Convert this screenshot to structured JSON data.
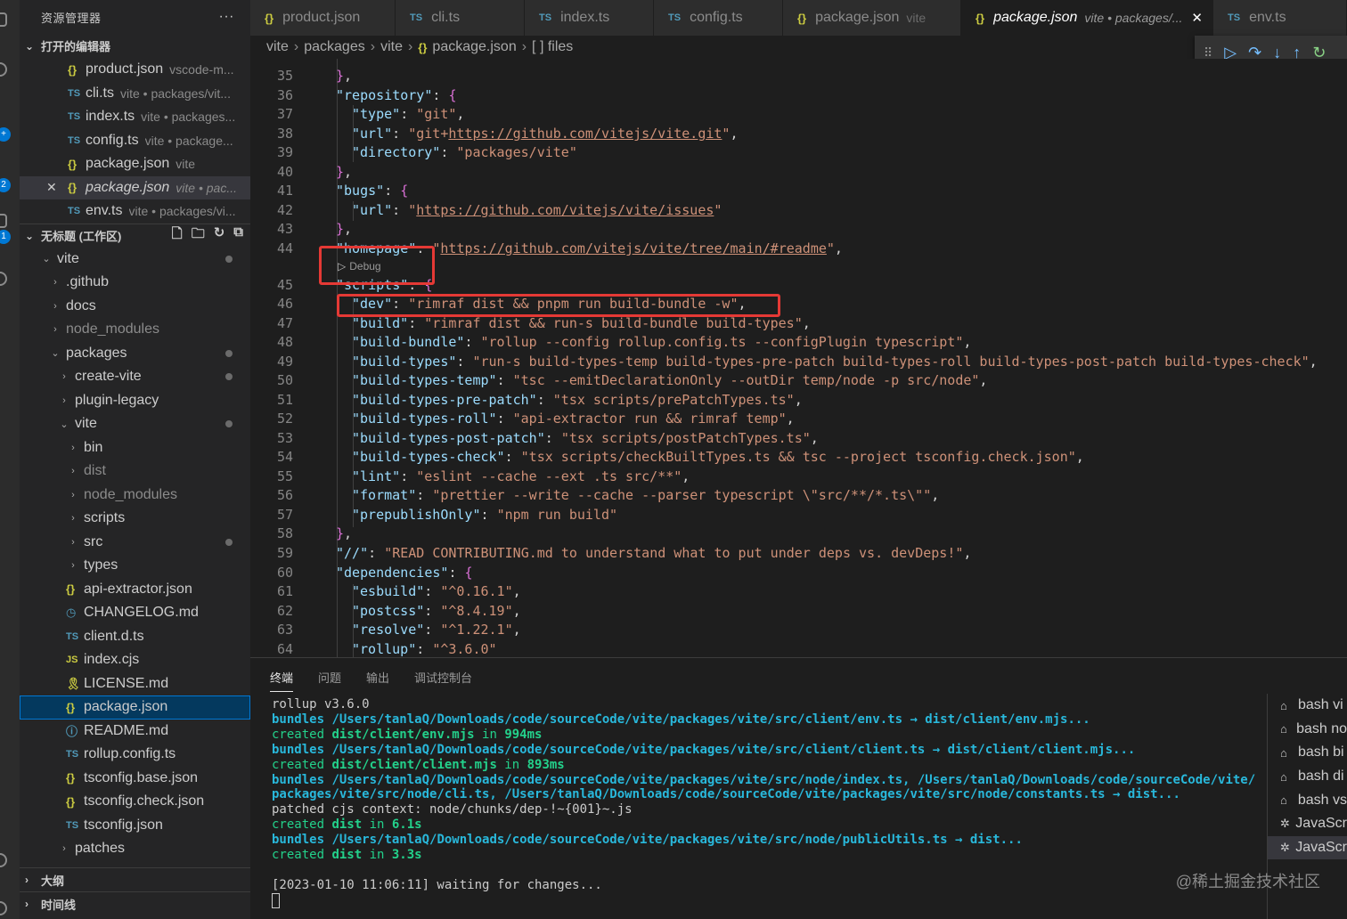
{
  "explorer": {
    "title": "资源管理器",
    "more": "···",
    "open_editors": {
      "title": "打开的编辑器",
      "items": [
        {
          "icon": "{}",
          "name": "product.json",
          "desc": "vscode-m..."
        },
        {
          "icon": "TS",
          "name": "cli.ts",
          "desc": "vite • packages/vit..."
        },
        {
          "icon": "TS",
          "name": "index.ts",
          "desc": "vite • packages..."
        },
        {
          "icon": "TS",
          "name": "config.ts",
          "desc": "vite • package..."
        },
        {
          "icon": "{}",
          "name": "package.json",
          "desc": "vite"
        },
        {
          "icon": "{}",
          "name": "package.json",
          "desc": "vite • pac...",
          "close": "✕"
        },
        {
          "icon": "TS",
          "name": "env.ts",
          "desc": "vite • packages/vi..."
        }
      ]
    },
    "workspace": {
      "title": "无标题 (工作区)",
      "tree": [
        {
          "chev": "⌄",
          "name": "vite"
        },
        {
          "chev": "›",
          "name": ".github"
        },
        {
          "chev": "›",
          "name": "docs"
        },
        {
          "chev": "›",
          "name": "node_modules"
        },
        {
          "chev": "⌄",
          "name": "packages"
        },
        {
          "chev": "›",
          "name": "create-vite"
        },
        {
          "chev": "›",
          "name": "plugin-legacy"
        },
        {
          "chev": "⌄",
          "name": "vite"
        },
        {
          "chev": "›",
          "name": "bin"
        },
        {
          "chev": "›",
          "name": "dist"
        },
        {
          "chev": "›",
          "name": "node_modules"
        },
        {
          "chev": "›",
          "name": "scripts"
        },
        {
          "chev": "›",
          "name": "src"
        },
        {
          "chev": "›",
          "name": "types"
        },
        {
          "icon": "{}",
          "name": "api-extractor.json"
        },
        {
          "icon": "◷",
          "name": "CHANGELOG.md"
        },
        {
          "icon": "TS",
          "name": "client.d.ts"
        },
        {
          "icon": "JS",
          "name": "index.cjs"
        },
        {
          "icon": "🎗",
          "name": "LICENSE.md"
        },
        {
          "icon": "{}",
          "name": "package.json"
        },
        {
          "icon": "ⓘ",
          "name": "README.md"
        },
        {
          "icon": "TS",
          "name": "rollup.config.ts"
        },
        {
          "icon": "{}",
          "name": "tsconfig.base.json"
        },
        {
          "icon": "{}",
          "name": "tsconfig.check.json"
        },
        {
          "icon": "TS",
          "name": "tsconfig.json"
        },
        {
          "chev": "›",
          "name": "patches"
        }
      ]
    },
    "outline": "大纲",
    "timeline": "时间线"
  },
  "tabs": [
    {
      "icon": "{}",
      "label": "product.json",
      "desc": ""
    },
    {
      "icon": "TS",
      "label": "cli.ts",
      "desc": ""
    },
    {
      "icon": "TS",
      "label": "index.ts",
      "desc": ""
    },
    {
      "icon": "TS",
      "label": "config.ts",
      "desc": ""
    },
    {
      "icon": "{}",
      "label": "package.json",
      "desc": "vite"
    },
    {
      "icon": "{}",
      "label": "package.json",
      "desc": "vite • packages/...",
      "close": "✕"
    },
    {
      "icon": "TS",
      "label": "env.ts",
      "desc": ""
    }
  ],
  "breadcrumb": {
    "parts": [
      "vite",
      "packages",
      "vite"
    ],
    "file": "package.json",
    "file_icon": "{}",
    "symbol": "[ ] files"
  },
  "codelens": "Debug",
  "editor": {
    "lines": [
      {
        "n": "35",
        "t": "},"
      },
      {
        "n": "36",
        "t": "\"repository\": {"
      },
      {
        "n": "37",
        "t": "\"type\": \"git\","
      },
      {
        "n": "38",
        "t": "\"url\": \"git+https://github.com/vitejs/vite.git\","
      },
      {
        "n": "39",
        "t": "\"directory\": \"packages/vite\""
      },
      {
        "n": "40",
        "t": "},"
      },
      {
        "n": "41",
        "t": "\"bugs\": {"
      },
      {
        "n": "42",
        "t": "\"url\": \"https://github.com/vitejs/vite/issues\""
      },
      {
        "n": "43",
        "t": "},"
      },
      {
        "n": "44",
        "t": "\"homepage\": \"https://github.com/vitejs/vite/tree/main/#readme\","
      },
      {
        "n": "45",
        "t": "\"scripts\": {"
      },
      {
        "n": "46",
        "t": "\"dev\": \"rimraf dist && pnpm run build-bundle -w\","
      },
      {
        "n": "47",
        "t": "\"build\": \"rimraf dist && run-s build-bundle build-types\","
      },
      {
        "n": "48",
        "t": "\"build-bundle\": \"rollup --config rollup.config.ts --configPlugin typescript\","
      },
      {
        "n": "49",
        "t": "\"build-types\": \"run-s build-types-temp build-types-pre-patch build-types-roll build-types-post-patch build-types-check\","
      },
      {
        "n": "50",
        "t": "\"build-types-temp\": \"tsc --emitDeclarationOnly --outDir temp/node -p src/node\","
      },
      {
        "n": "51",
        "t": "\"build-types-pre-patch\": \"tsx scripts/prePatchTypes.ts\","
      },
      {
        "n": "52",
        "t": "\"build-types-roll\": \"api-extractor run && rimraf temp\","
      },
      {
        "n": "53",
        "t": "\"build-types-post-patch\": \"tsx scripts/postPatchTypes.ts\","
      },
      {
        "n": "54",
        "t": "\"build-types-check\": \"tsx scripts/checkBuiltTypes.ts && tsc --project tsconfig.check.json\","
      },
      {
        "n": "55",
        "t": "\"lint\": \"eslint --cache --ext .ts src/**\","
      },
      {
        "n": "56",
        "t": "\"format\": \"prettier --write --cache --parser typescript \\\"src/**/*.ts\\\"\","
      },
      {
        "n": "57",
        "t": "\"prepublishOnly\": \"npm run build\""
      },
      {
        "n": "58",
        "t": "},"
      },
      {
        "n": "59",
        "t": "\"//\": \"READ CONTRIBUTING.md to understand what to put under deps vs. devDeps!\","
      },
      {
        "n": "60",
        "t": "\"dependencies\": {"
      },
      {
        "n": "61",
        "t": "\"esbuild\": \"^0.16.1\","
      },
      {
        "n": "62",
        "t": "\"postcss\": \"^8.4.19\","
      },
      {
        "n": "63",
        "t": "\"resolve\": \"^1.22.1\","
      },
      {
        "n": "64",
        "t": "\"rollup\": \"^3.6.0\""
      }
    ]
  },
  "panel": {
    "tabs": [
      "终端",
      "问题",
      "输出",
      "调试控制台"
    ],
    "terminal": [
      {
        "parts": [
          {
            "c": "",
            "t": "rollup v3.6.0"
          }
        ]
      },
      {
        "parts": [
          {
            "c": "t-cyan",
            "t": "bundles "
          },
          {
            "c": "t-cyan",
            "t": "/Users/tanlaQ/Downloads/code/sourceCode/vite/packages/vite/src/client/env.ts → dist/client/env.mjs..."
          }
        ]
      },
      {
        "parts": [
          {
            "c": "t-green",
            "t": "created "
          },
          {
            "c": "t-greenb",
            "t": "dist/client/env.mjs"
          },
          {
            "c": "t-green",
            "t": " in "
          },
          {
            "c": "t-greenb",
            "t": "994ms"
          }
        ]
      },
      {
        "parts": [
          {
            "c": "t-cyan",
            "t": "bundles "
          },
          {
            "c": "t-cyan",
            "t": "/Users/tanlaQ/Downloads/code/sourceCode/vite/packages/vite/src/client/client.ts → dist/client/client.mjs..."
          }
        ]
      },
      {
        "parts": [
          {
            "c": "t-green",
            "t": "created "
          },
          {
            "c": "t-greenb",
            "t": "dist/client/client.mjs"
          },
          {
            "c": "t-green",
            "t": " in "
          },
          {
            "c": "t-greenb",
            "t": "893ms"
          }
        ]
      },
      {
        "parts": [
          {
            "c": "t-cyan",
            "t": "bundles "
          },
          {
            "c": "t-cyan",
            "t": "/Users/tanlaQ/Downloads/code/sourceCode/vite/packages/vite/src/node/index.ts, /Users/tanlaQ/Downloads/code/sourceCode/vite/packages/vite/src/node/cli.ts, /Users/tanlaQ/Downloads/code/sourceCode/vite/packages/vite/src/node/constants.ts → dist..."
          }
        ]
      },
      {
        "parts": [
          {
            "c": "",
            "t": "patched cjs context: node/chunks/dep-!~{001}~.js"
          }
        ]
      },
      {
        "parts": [
          {
            "c": "t-green",
            "t": "created "
          },
          {
            "c": "t-greenb",
            "t": "dist"
          },
          {
            "c": "t-green",
            "t": " in "
          },
          {
            "c": "t-greenb",
            "t": "6.1s"
          }
        ]
      },
      {
        "parts": [
          {
            "c": "t-cyan",
            "t": "bundles "
          },
          {
            "c": "t-cyan",
            "t": "/Users/tanlaQ/Downloads/code/sourceCode/vite/packages/vite/src/node/publicUtils.ts → dist..."
          }
        ]
      },
      {
        "parts": [
          {
            "c": "t-green",
            "t": "created "
          },
          {
            "c": "t-greenb",
            "t": "dist"
          },
          {
            "c": "t-green",
            "t": " in "
          },
          {
            "c": "t-greenb",
            "t": "3.3s"
          }
        ]
      },
      {
        "parts": [
          {
            "c": "",
            "t": " "
          }
        ]
      },
      {
        "parts": [
          {
            "c": "",
            "t": "[2023-01-10 11:06:11] waiting for changes..."
          }
        ]
      }
    ],
    "terminal_list": [
      {
        "icon": "⌂",
        "label": "bash vi"
      },
      {
        "icon": "⌂",
        "label": "bash no"
      },
      {
        "icon": "⌂",
        "label": "bash bi"
      },
      {
        "icon": "⌂",
        "label": "bash di"
      },
      {
        "icon": "⌂",
        "label": "bash vs"
      },
      {
        "icon": "✲",
        "label": "JavaScr"
      },
      {
        "icon": "✲",
        "label": "JavaScr"
      }
    ]
  },
  "watermark": "@稀土掘金技术社区",
  "colors": {
    "accent": "#0078d4",
    "highlight": "#e53935",
    "json_icon": "#cbcb41",
    "ts_icon": "#519aba"
  }
}
